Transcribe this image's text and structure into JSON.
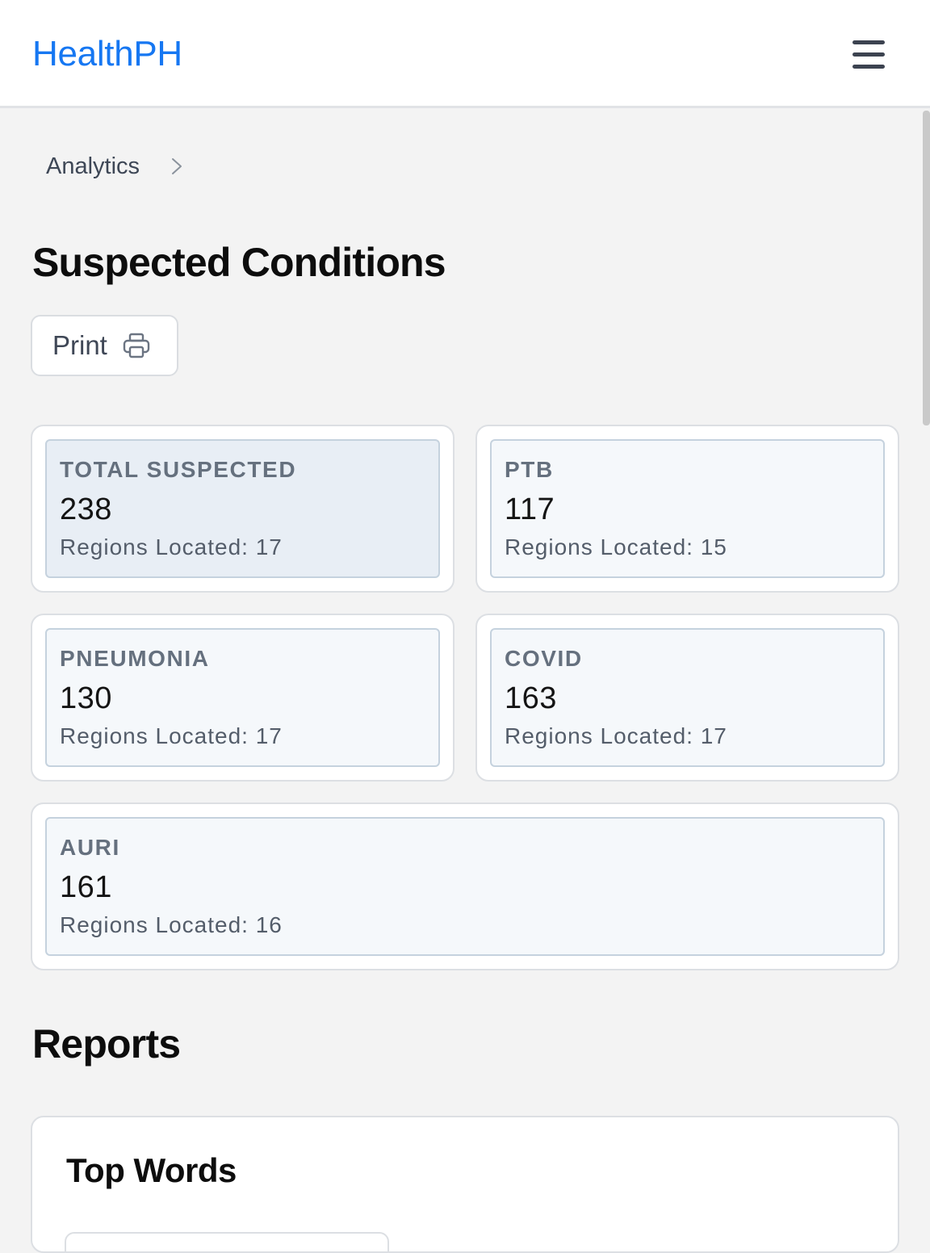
{
  "header": {
    "brand": "HealthPH",
    "menu_icon": "hamburger-menu-icon"
  },
  "breadcrumb": {
    "items": [
      "Analytics"
    ],
    "separator_icon": "chevron-right-icon"
  },
  "page": {
    "title": "Suspected Conditions"
  },
  "toolbar": {
    "print_label": "Print",
    "print_icon": "printer-icon"
  },
  "cards": [
    {
      "label": "TOTAL SUSPECTED",
      "value": "238",
      "regions": "Regions Located: 17",
      "selected": true
    },
    {
      "label": "PTB",
      "value": "117",
      "regions": "Regions Located: 15"
    },
    {
      "label": "PNEUMONIA",
      "value": "130",
      "regions": "Regions Located: 17"
    },
    {
      "label": "COVID",
      "value": "163",
      "regions": "Regions Located: 17"
    },
    {
      "label": "AURI",
      "value": "161",
      "regions": "Regions Located: 16"
    }
  ],
  "reports": {
    "title": "Reports",
    "top_words": {
      "title": "Top Words"
    }
  },
  "colors": {
    "brand": "#1677f2",
    "card_border": "#c5d2de",
    "card_bg": "#f5f8fb",
    "card_selected_bg": "#e8eef5"
  }
}
